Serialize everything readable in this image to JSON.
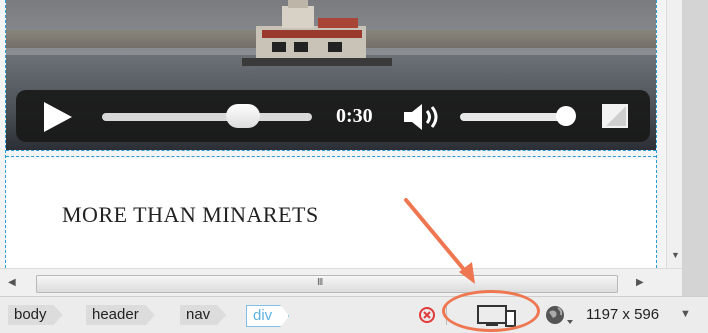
{
  "video": {
    "time": "0:30",
    "progress_fraction": 0.65,
    "volume_fraction": 0.9
  },
  "content": {
    "heading": "MORE THAN MINARETS"
  },
  "scrollbar": {
    "grip": "III"
  },
  "status": {
    "breadcrumbs": [
      "body",
      "header",
      "nav",
      "div"
    ],
    "window_size": "1197 x 596"
  },
  "colors": {
    "accent_guides": "#2a9fd6",
    "annotation_orange": "#ee7752",
    "error_red": "#e03a3a"
  },
  "icons": {
    "play": "play-icon",
    "volume": "speaker-icon",
    "fullscreen": "fullscreen-icon",
    "error": "error-icon",
    "device": "device-preview-icon",
    "globe": "globe-icon"
  }
}
